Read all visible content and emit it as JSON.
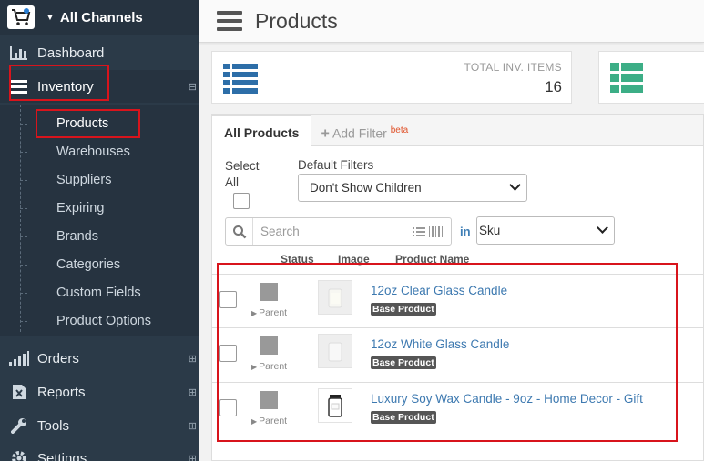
{
  "sidebar": {
    "channel_label": "All Channels",
    "nav": [
      {
        "label": "Dashboard",
        "icon": "bar-chart-icon"
      },
      {
        "label": "Inventory",
        "icon": "list-icon"
      },
      {
        "label": "Orders",
        "icon": "signal-bars-icon"
      },
      {
        "label": "Reports",
        "icon": "excel-file-icon"
      },
      {
        "label": "Tools",
        "icon": "wrench-icon"
      },
      {
        "label": "Settings",
        "icon": "gear-icon"
      }
    ],
    "inventory_sub": [
      "Products",
      "Warehouses",
      "Suppliers",
      "Expiring",
      "Brands",
      "Categories",
      "Custom Fields",
      "Product Options"
    ]
  },
  "header": {
    "title": "Products"
  },
  "stats": {
    "total_label": "TOTAL INV. ITEMS",
    "total_value": "16"
  },
  "tabs": {
    "active": "All Products",
    "add_filter": "Add Filter",
    "beta": "beta"
  },
  "filters": {
    "select_all": "Select All",
    "default_filters_label": "Default Filters",
    "default_filter_value": "Don't Show Children",
    "search_placeholder": "Search",
    "in_label": "in",
    "search_field_value": "Sku"
  },
  "table": {
    "columns": [
      "Status",
      "Image",
      "Product Name"
    ],
    "rows": [
      {
        "parent": "Parent",
        "name": "12oz Clear Glass Candle",
        "badge": "Base Product"
      },
      {
        "parent": "Parent",
        "name": "12oz White Glass Candle",
        "badge": "Base Product"
      },
      {
        "parent": "Parent",
        "name": "Luxury Soy Wax Candle - 9oz - Home Decor - Gift",
        "badge": "Base Product"
      }
    ]
  },
  "colors": {
    "sidebar": "#2b3a48",
    "link": "#3d79b0",
    "highlight": "#d8141c"
  }
}
